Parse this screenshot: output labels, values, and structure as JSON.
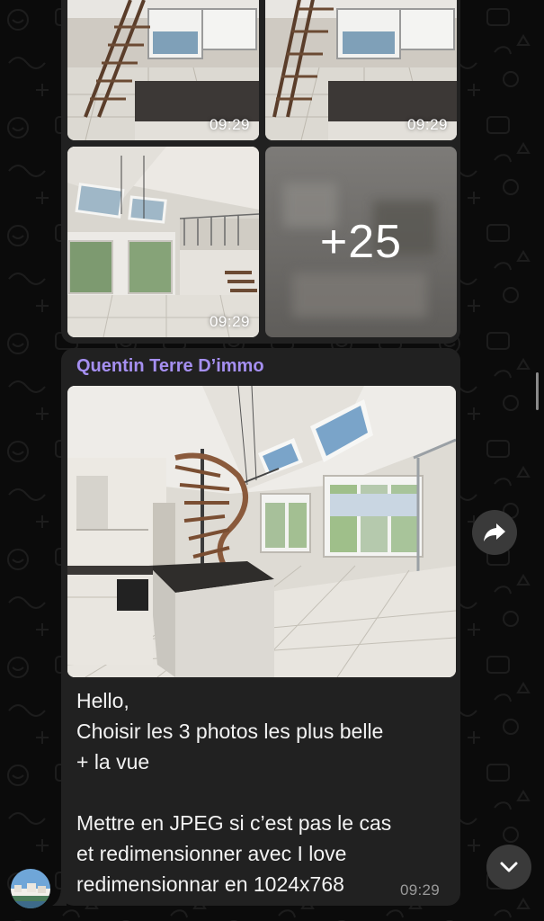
{
  "chat": {
    "photo_grid": {
      "tiles": [
        {
          "time": "09:29"
        },
        {
          "time": "09:29"
        },
        {
          "time": "09:29"
        },
        {
          "more_label": "+25"
        }
      ]
    },
    "message": {
      "sender": "Quentin Terre D’immo",
      "sender_color": "#a58ff0",
      "text_lines": [
        "Hello,",
        "Choisir les 3 photos les plus belle",
        "+ la vue",
        "",
        "Mettre en JPEG si c’est pas le cas",
        "et redimensionner avec I love",
        "redimensionnar en 1024x768"
      ],
      "time": "09:29"
    },
    "buttons": {
      "share_icon": "share-arrow-icon",
      "scroll_down_icon": "chevron-down-icon"
    }
  },
  "colors": {
    "background": "#0b0b0b",
    "bubble": "#212121",
    "button": "#3a3a3a"
  }
}
